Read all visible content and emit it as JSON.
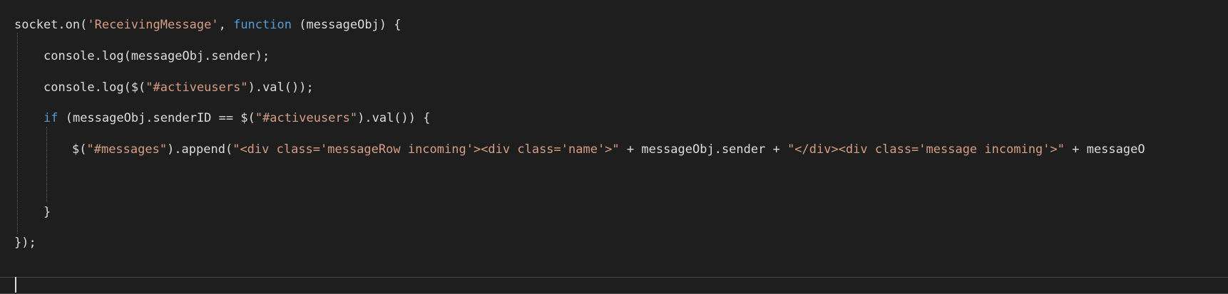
{
  "editor": {
    "language": "javascript",
    "colors": {
      "background": "#1e1e1e",
      "plain": "#dcdcdc",
      "string": "#d69d85",
      "keyword": "#569cd6"
    },
    "lines": [
      {
        "tokens": [
          {
            "kind": "plain",
            "text": "socket.on("
          },
          {
            "kind": "string",
            "text": "'ReceivingMessage'"
          },
          {
            "kind": "plain",
            "text": ", "
          },
          {
            "kind": "keyword",
            "text": "function"
          },
          {
            "kind": "plain",
            "text": " (messageObj) {"
          }
        ]
      },
      {
        "tokens": [
          {
            "kind": "plain",
            "text": "console.log(messageObj.sender);"
          }
        ]
      },
      {
        "tokens": [
          {
            "kind": "plain",
            "text": "console.log($("
          },
          {
            "kind": "string",
            "text": "\"#activeusers\""
          },
          {
            "kind": "plain",
            "text": ").val());"
          }
        ]
      },
      {
        "tokens": [
          {
            "kind": "keyword",
            "text": "if"
          },
          {
            "kind": "plain",
            "text": " (messageObj.senderID == $("
          },
          {
            "kind": "string",
            "text": "\"#activeusers\""
          },
          {
            "kind": "plain",
            "text": ").val()) {"
          }
        ]
      },
      {
        "tokens": [
          {
            "kind": "plain",
            "text": "$("
          },
          {
            "kind": "string",
            "text": "\"#messages\""
          },
          {
            "kind": "plain",
            "text": ").append("
          },
          {
            "kind": "string",
            "text": "\"<div class='messageRow incoming'><div class='name'>\""
          },
          {
            "kind": "plain",
            "text": " + messageObj.sender + "
          },
          {
            "kind": "string",
            "text": "\"</div><div class='message incoming'>\""
          },
          {
            "kind": "plain",
            "text": " + messageO"
          }
        ]
      },
      {
        "tokens": [
          {
            "kind": "plain",
            "text": "}"
          }
        ]
      },
      {
        "tokens": [
          {
            "kind": "plain",
            "text": "});"
          }
        ]
      }
    ]
  }
}
